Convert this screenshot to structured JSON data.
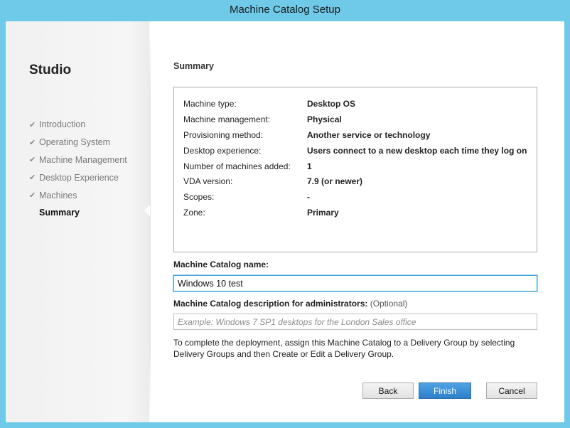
{
  "window": {
    "title": "Machine Catalog Setup"
  },
  "sidebar": {
    "app_name": "Studio",
    "steps": [
      {
        "label": "Introduction",
        "done": true
      },
      {
        "label": "Operating System",
        "done": true
      },
      {
        "label": "Machine Management",
        "done": true
      },
      {
        "label": "Desktop Experience",
        "done": true
      },
      {
        "label": "Machines",
        "done": true
      },
      {
        "label": "Summary",
        "done": false,
        "current": true
      }
    ],
    "check_glyph": "✔"
  },
  "main": {
    "section_title": "Summary",
    "summary": [
      {
        "key": "Machine type:",
        "value": "Desktop OS"
      },
      {
        "key": "Machine management:",
        "value": "Physical"
      },
      {
        "key": "Provisioning method:",
        "value": "Another service or technology"
      },
      {
        "key": "Desktop experience:",
        "value": "Users connect to a new desktop each time they log on"
      },
      {
        "key": "Number of machines added:",
        "value": "1"
      },
      {
        "key": "VDA version:",
        "value": "7.9 (or newer)"
      },
      {
        "key": "Scopes:",
        "value": "-"
      },
      {
        "key": "Zone:",
        "value": "Primary"
      }
    ],
    "catalog_name_label": "Machine Catalog name:",
    "catalog_name_value": "Windows 10 test",
    "description_label": "Machine Catalog description for administrators:",
    "description_optional": "(Optional)",
    "description_placeholder": "Example: Windows 7 SP1 desktops for the London Sales office",
    "help_text": "To complete the deployment, assign this Machine Catalog to a Delivery Group by selecting Delivery Groups and then Create or Edit a Delivery Group."
  },
  "buttons": {
    "back": "Back",
    "finish": "Finish",
    "cancel": "Cancel"
  },
  "colors": {
    "title_bar": "#6ecae8",
    "finish_button": "#2d7fc9",
    "input_focus_border": "#4aa3df"
  }
}
